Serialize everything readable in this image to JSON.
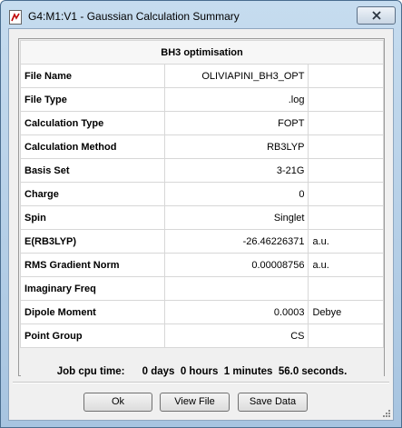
{
  "window": {
    "title": "G4:M1:V1 - Gaussian Calculation Summary",
    "close_label": "close"
  },
  "summary": {
    "heading": "BH3 optimisation",
    "rows": [
      {
        "label": "File Name",
        "value": "OLIVIAPINI_BH3_OPT",
        "unit": ""
      },
      {
        "label": "File Type",
        "value": ".log",
        "unit": ""
      },
      {
        "label": "Calculation Type",
        "value": "FOPT",
        "unit": ""
      },
      {
        "label": "Calculation Method",
        "value": "RB3LYP",
        "unit": ""
      },
      {
        "label": "Basis Set",
        "value": "3-21G",
        "unit": ""
      },
      {
        "label": "Charge",
        "value": "0",
        "unit": ""
      },
      {
        "label": "Spin",
        "value": "Singlet",
        "unit": ""
      },
      {
        "label": "E(RB3LYP)",
        "value": "-26.46226371",
        "unit": "a.u."
      },
      {
        "label": "RMS Gradient Norm",
        "value": "0.00008756",
        "unit": "a.u."
      },
      {
        "label": "Imaginary Freq",
        "value": "",
        "unit": ""
      },
      {
        "label": "Dipole Moment",
        "value": "0.0003",
        "unit": "Debye"
      },
      {
        "label": "Point Group",
        "value": "CS",
        "unit": ""
      }
    ],
    "cpu_time": "Job cpu time:      0 days  0 hours  1 minutes  56.0 seconds."
  },
  "buttons": {
    "ok": "Ok",
    "view_file": "View File",
    "save_data": "Save Data"
  }
}
